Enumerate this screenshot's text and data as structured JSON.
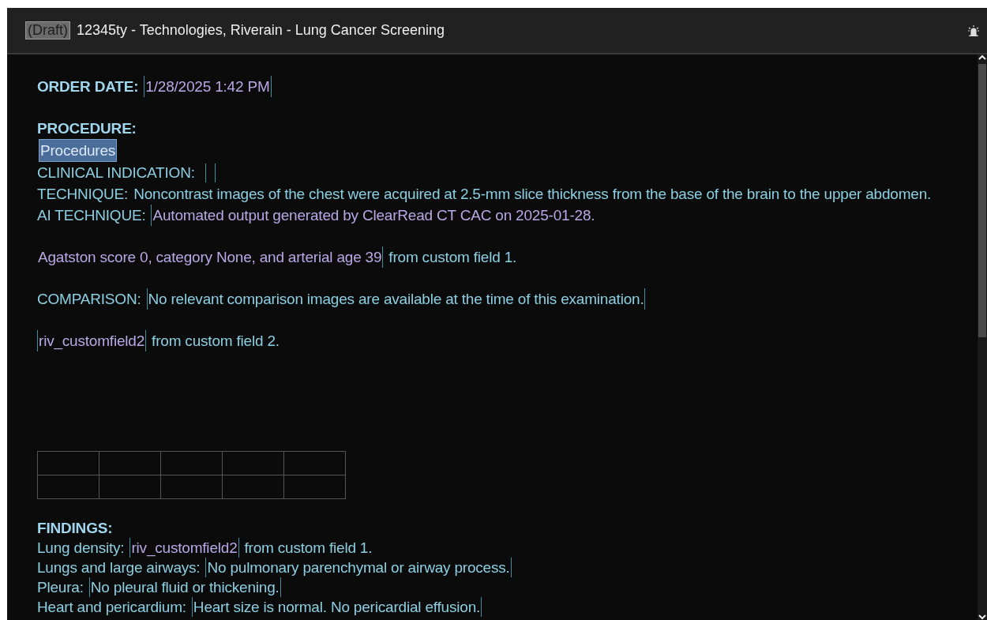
{
  "window": {
    "badge": "(Draft)",
    "title": "12345ty - Technologies, Riverain - Lung Cancer Screening"
  },
  "sections": [
    {
      "lines": [
        {
          "parts": [
            {
              "kind": "heading",
              "text": "ORDER DATE:"
            },
            {
              "kind": "field",
              "color": "#b8a8e6",
              "open_bracket": true,
              "close_bracket": true,
              "text": "1/28/2025 1:42 PM"
            }
          ]
        }
      ]
    },
    {
      "lines": [
        {
          "parts": [
            {
              "kind": "heading",
              "text": "PROCEDURE:"
            }
          ]
        },
        {
          "parts": [
            {
              "kind": "selection",
              "text": "Procedures"
            }
          ]
        },
        {
          "parts": [
            {
              "kind": "label",
              "text": "CLINICAL INDICATION:"
            },
            {
              "kind": "empty-field"
            }
          ]
        },
        {
          "parts": [
            {
              "kind": "label",
              "text": "TECHNIQUE:"
            },
            {
              "kind": "text",
              "text": "Noncontrast images of the chest were acquired at 2.5-mm slice thickness from the base of the brain to the upper abdomen."
            }
          ]
        },
        {
          "parts": [
            {
              "kind": "label",
              "text": "AI TECHNIQUE:"
            },
            {
              "kind": "field",
              "open_bracket": true,
              "close_bracket": false,
              "color": "#b8a8e6",
              "text": "Automated output generated by ClearRead CT CAC on 2025-01-28."
            }
          ]
        }
      ]
    },
    {
      "lines": [
        {
          "parts": [
            {
              "kind": "field",
              "open_bracket": false,
              "close_bracket": true,
              "color": "#b8a8e6",
              "text": "Agatston score 0, category None, and arterial age 39"
            },
            {
              "kind": "text",
              "text": "from custom field 1."
            }
          ]
        }
      ]
    },
    {
      "lines": [
        {
          "parts": [
            {
              "kind": "label",
              "text": "COMPARISON:"
            },
            {
              "kind": "field",
              "open_bracket": true,
              "close_bracket": true,
              "color": "#8ccfe2",
              "text": "No relevant comparison images are available at the time of this examination."
            }
          ]
        }
      ]
    },
    {
      "lines": [
        {
          "parts": [
            {
              "kind": "field",
              "open_bracket": true,
              "close_bracket": true,
              "color": "#b8a8e6",
              "text": "riv_customfield2"
            },
            {
              "kind": "text",
              "text": "from custom field 2."
            }
          ]
        }
      ]
    }
  ],
  "table": {
    "columns": [
      {
        "kind": "blank"
      },
      {
        "kind": "blank"
      },
      {
        "kind": "blank"
      },
      {
        "kind": "blank"
      },
      {
        "kind": "blank"
      }
    ],
    "rows": [
      {
        "kind": "blank"
      },
      {
        "kind": "blank"
      }
    ]
  },
  "findings": {
    "lines": [
      {
        "parts": [
          {
            "kind": "heading",
            "text": "FINDINGS:"
          }
        ]
      },
      {
        "parts": [
          {
            "kind": "label",
            "text": "Lung density:"
          },
          {
            "kind": "field",
            "open_bracket": true,
            "close_bracket": true,
            "color": "#b8a8e6",
            "text": "riv_customfield2"
          },
          {
            "kind": "text",
            "text": "from custom field 1."
          }
        ]
      },
      {
        "parts": [
          {
            "kind": "label",
            "text": "Lungs and large airways:"
          },
          {
            "kind": "field",
            "open_bracket": true,
            "close_bracket": true,
            "color": "#8ccfe2",
            "text": "No pulmonary parenchymal or airway process."
          }
        ]
      },
      {
        "parts": [
          {
            "kind": "label",
            "text": "Pleura:"
          },
          {
            "kind": "field",
            "open_bracket": true,
            "close_bracket": true,
            "color": "#8ccfe2",
            "text": "No pleural fluid or thickening."
          }
        ]
      },
      {
        "parts": [
          {
            "kind": "label",
            "text": "Heart and pericardium:"
          },
          {
            "kind": "field",
            "open_bracket": true,
            "close_bracket": true,
            "color": "#8ccfe2",
            "text": "Heart size is normal. No pericardial effusion."
          }
        ]
      }
    ]
  }
}
